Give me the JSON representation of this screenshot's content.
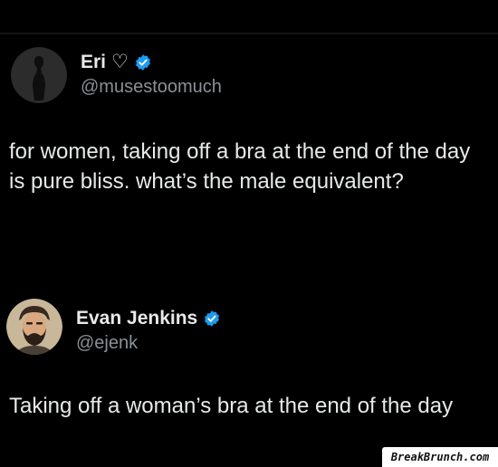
{
  "tweet": {
    "display_name": "Eri",
    "name_symbol": "♡",
    "handle": "@musestoomuch",
    "text": "for women, taking off a bra at the end of the day\nis pure bliss. what’s the male equivalent?",
    "verified_color": "#1d9bf0"
  },
  "reply": {
    "display_name": "Evan Jenkins",
    "handle": "@ejenk",
    "text": "Taking off a woman’s bra at the end of the day",
    "verified_color": "#1d9bf0"
  },
  "watermark": {
    "text": "BreakBrunch.com"
  }
}
